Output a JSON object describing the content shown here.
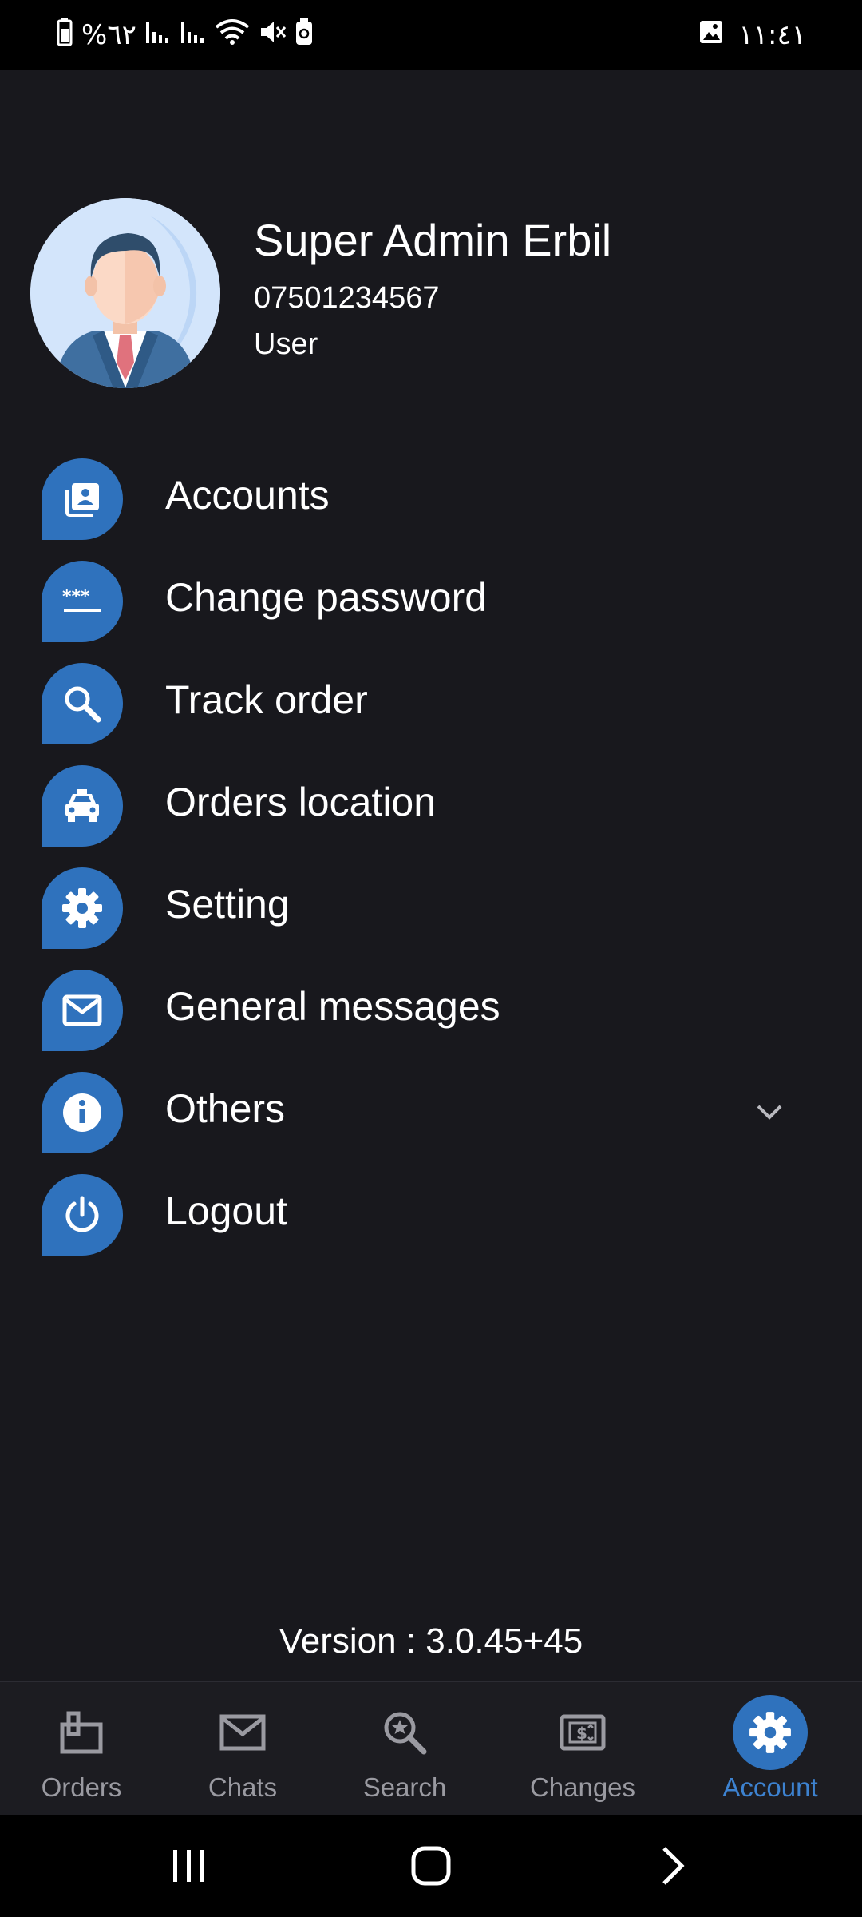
{
  "status_bar": {
    "battery_percent": "%٦٢",
    "time": "١١:٤١",
    "icons": [
      "battery-icon",
      "signal-icon",
      "signal-icon",
      "wifi-icon",
      "mute-icon",
      "battery-saver-icon",
      "image-notification-icon"
    ]
  },
  "profile": {
    "name": "Super Admin Erbil",
    "phone": "07501234567",
    "role": "User",
    "avatar_icon": "avatar-icon"
  },
  "menu": {
    "items": [
      {
        "label": "Accounts",
        "icon": "accounts-icon"
      },
      {
        "label": "Change password",
        "icon": "password-icon"
      },
      {
        "label": "Track order",
        "icon": "search-icon"
      },
      {
        "label": "Orders location",
        "icon": "car-icon"
      },
      {
        "label": "Setting",
        "icon": "gear-icon"
      },
      {
        "label": "General messages",
        "icon": "mail-icon"
      },
      {
        "label": "Others",
        "icon": "info-icon"
      },
      {
        "label": "Logout",
        "icon": "power-icon"
      }
    ]
  },
  "version_text": "Version : 3.0.45+45",
  "bottom_nav": {
    "items": [
      {
        "label": "Orders",
        "icon": "orders-icon"
      },
      {
        "label": "Chats",
        "icon": "mail-icon"
      },
      {
        "label": "Search",
        "icon": "search-star-icon"
      },
      {
        "label": "Changes",
        "icon": "money-icon"
      },
      {
        "label": "Account",
        "icon": "gear-icon",
        "active": true
      }
    ]
  },
  "colors": {
    "background": "#18181d",
    "accent": "#2f72bd",
    "active_label": "#3d82d0",
    "inactive_label": "#9a9aa1"
  }
}
